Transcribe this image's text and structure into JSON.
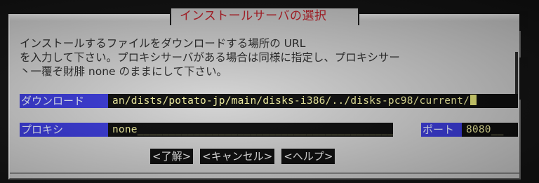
{
  "dialog": {
    "title": "インストールサーバの選択",
    "message_lines": [
      "インストールするファイルをダウンロードする場所の URL",
      "を入力して下さい。プロキシサーバがある場合は同様に指定し、プロキシサー",
      "丶一覆ぞ財腓 none のままにして下さい。"
    ]
  },
  "fields": {
    "download": {
      "label": "ダウンロード",
      "value": "an/dists/potato-jp/main/disks-i386/../disks-pc98/current/"
    },
    "proxy": {
      "label": "プロキシ",
      "value": "none__________________________________________"
    },
    "port": {
      "label": "ポート",
      "value": "8080__"
    }
  },
  "buttons": {
    "ok": "<了解>",
    "cancel": "<キャンセル>",
    "help": "<ヘルプ>"
  },
  "colors": {
    "dialog_bg": "#d4d4d4",
    "title_text": "#c8202a",
    "label_bg": "#3a3adc",
    "label_text": "#e4ebff",
    "field_bg": "#0b0b0b",
    "field_text": "#f2f0a0",
    "button_bg": "#0b0b0b",
    "button_text": "#f0f0f0"
  }
}
